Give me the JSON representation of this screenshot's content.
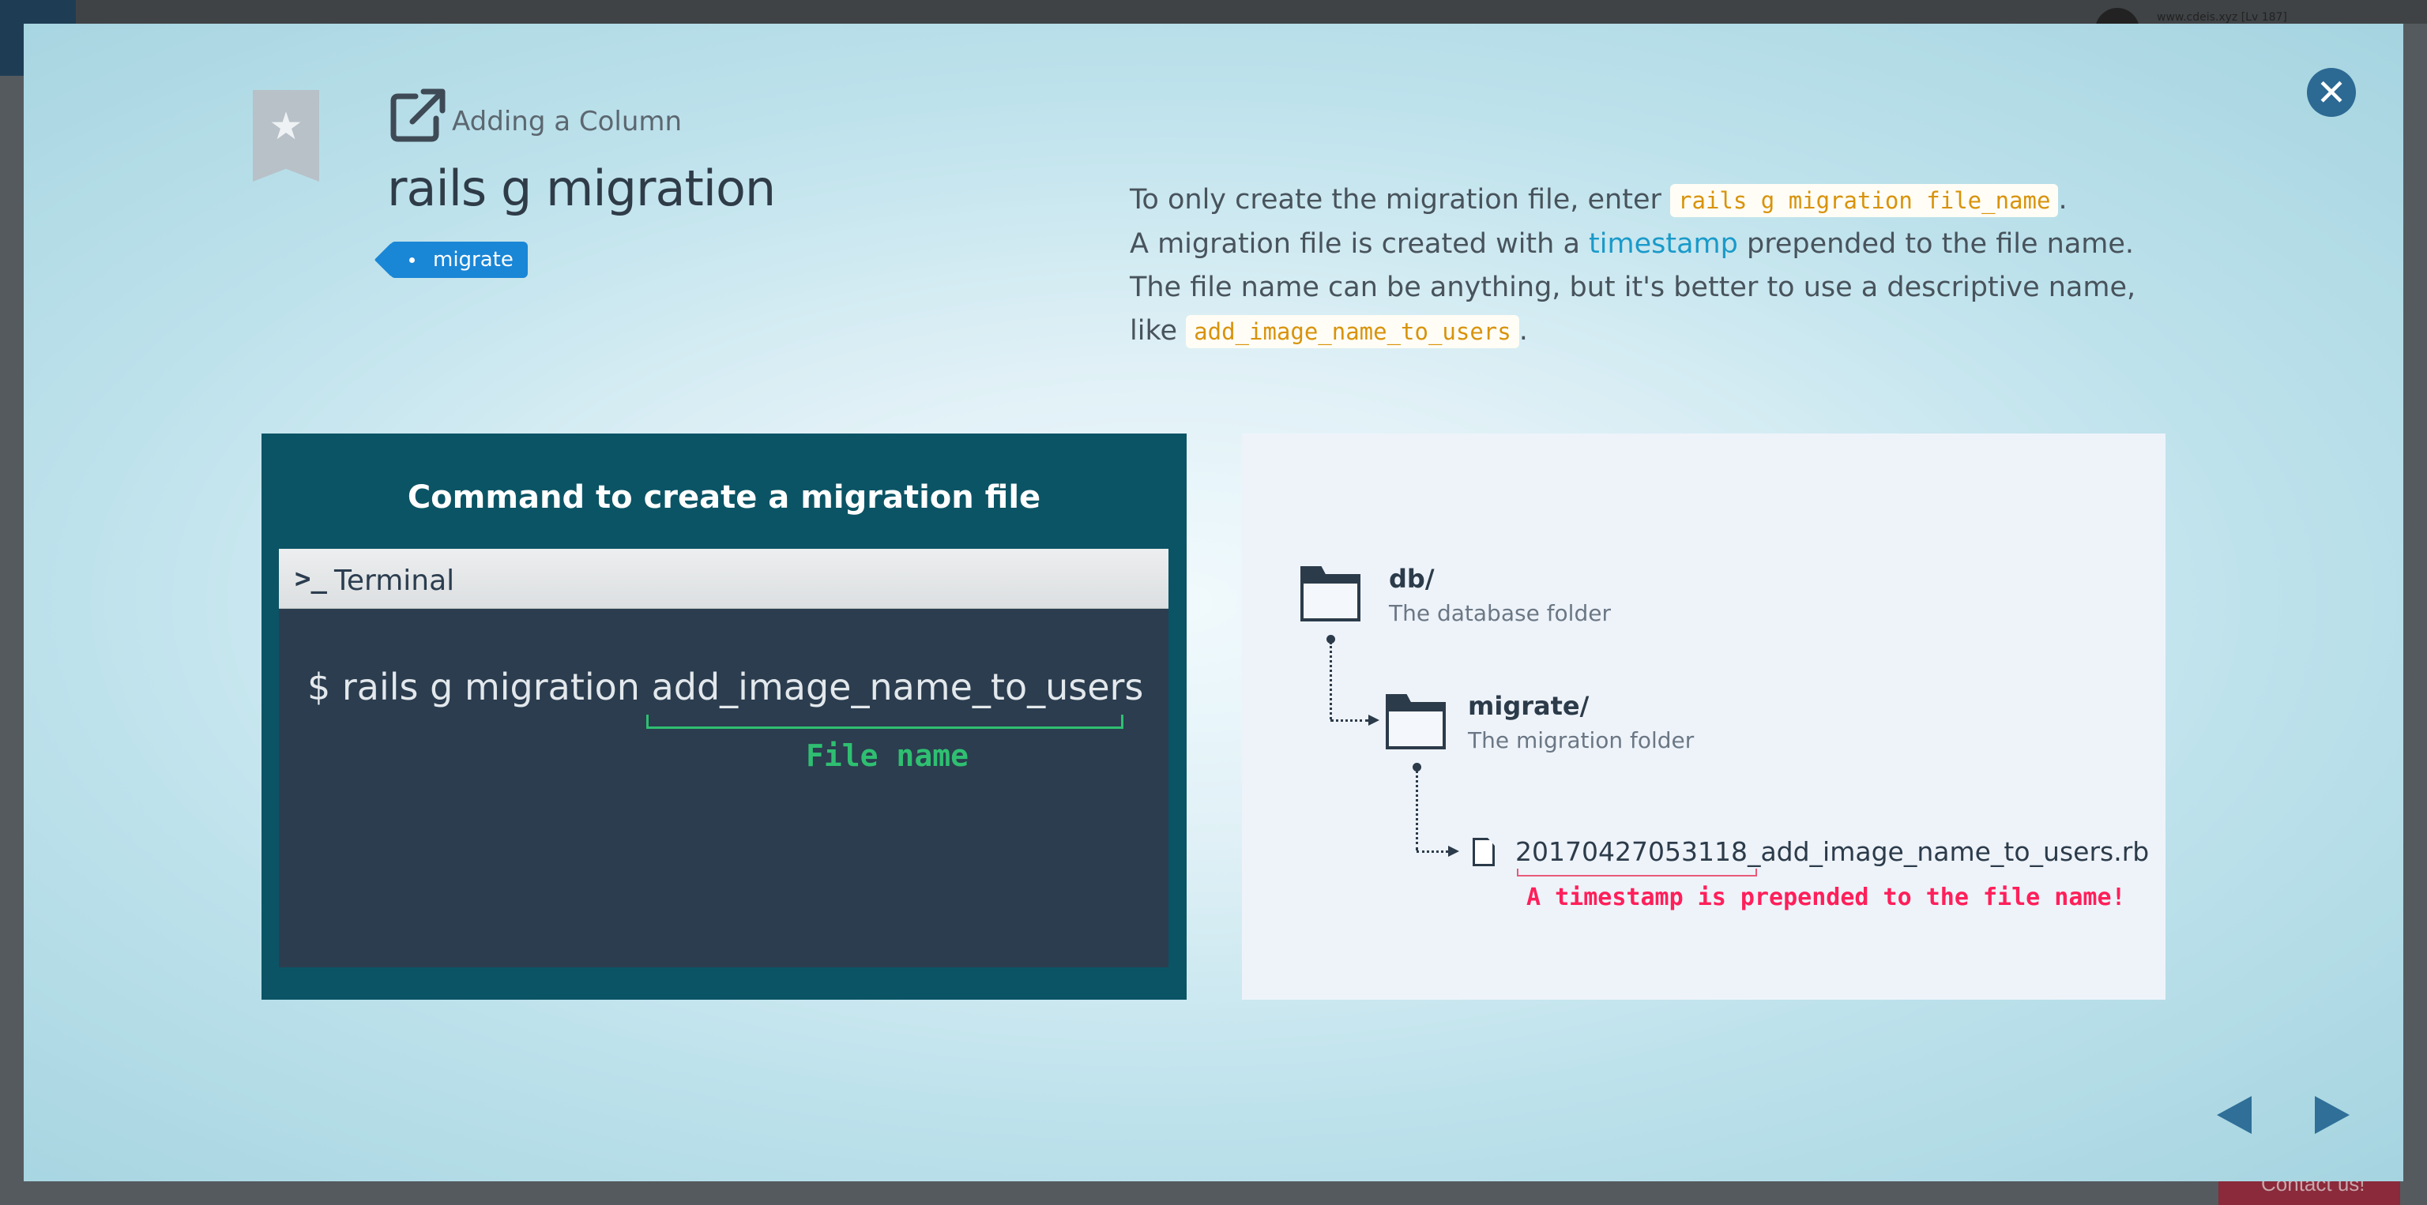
{
  "background": {
    "url_hint": "www.cdeis.xyz [Lv 187]",
    "contact_label": "Contact us!"
  },
  "modal": {
    "lesson_label": "Adding a Column",
    "title": "rails g migration",
    "tag": "migrate",
    "description": {
      "line1_pre": "To only create the migration file, enter",
      "line1_code": "rails g migration file_name",
      "line1_post": ".",
      "line2_pre": "A migration file is created with a",
      "line2_link": "timestamp",
      "line2_post": "prepended to the file name.",
      "line3": "The file name can be anything, but it's better to use a descriptive name,",
      "line4_pre": "like",
      "line4_code": "add_image_name_to_users",
      "line4_post": "."
    }
  },
  "terminal_figure": {
    "title": "Command to create a migration file",
    "window_label": "Terminal",
    "prompt_icon": ">_",
    "command": "$  rails g migration add_image_name_to_users",
    "annotation": "File name"
  },
  "tree_figure": {
    "db_name": "db/",
    "db_desc": "The database folder",
    "migrate_name": "migrate/",
    "migrate_desc": "The migration folder",
    "file_name": "20170427053118_add_image_name_to_users.rb",
    "timestamp_note": "A timestamp is prepended to the file name!"
  },
  "icons": {
    "close": "close-icon",
    "bookmark": "bookmark-icon",
    "external": "external-link-icon",
    "prev": "arrow-left-icon",
    "next": "arrow-right-icon",
    "folder": "folder-icon",
    "file": "file-icon"
  },
  "colors": {
    "accent": "#1a86d6",
    "terminal_bg": "#0b5465",
    "code_text": "#d8930c",
    "link": "#1a9ac9",
    "success": "#2fbf71",
    "highlight": "#ff1f5a"
  }
}
